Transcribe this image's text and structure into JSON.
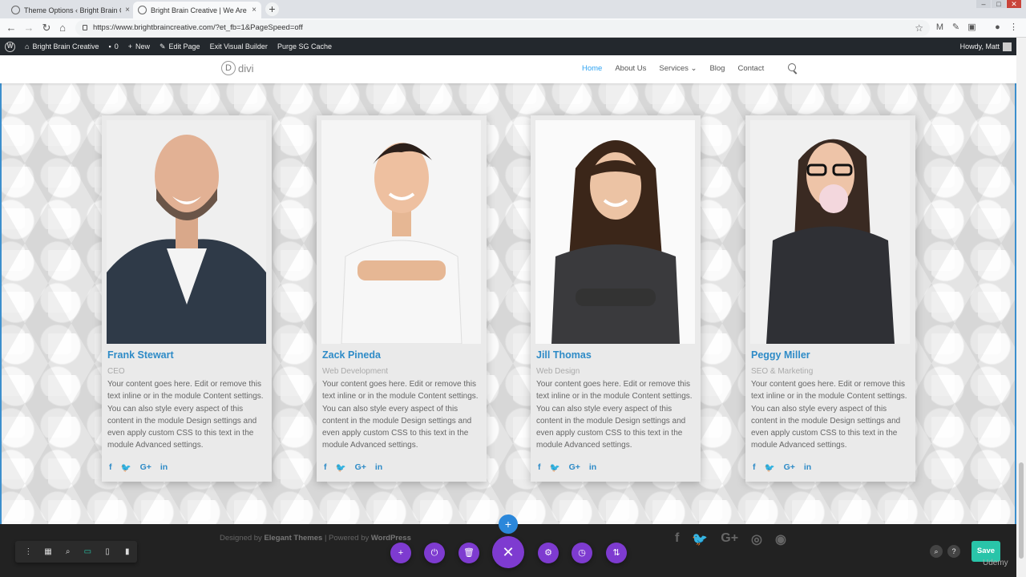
{
  "browser": {
    "tabs": [
      {
        "title": "Theme Options ‹ Bright Brain Cre",
        "close": "×"
      },
      {
        "title": "Bright Brain Creative | We Are Br",
        "close": "×"
      }
    ],
    "new_tab": "+",
    "url": "https://www.brightbraincreative.com/?et_fb=1&PageSpeed=off"
  },
  "wp_admin_bar": {
    "site_name": "Bright Brain Creative",
    "comments_count": "0",
    "new_label": "New",
    "edit_page_label": "Edit Page",
    "exit_vb_label": "Exit Visual Builder",
    "purge_label": "Purge SG Cache",
    "howdy": "Howdy, Matt"
  },
  "site": {
    "logo_text": "divi",
    "logo_mark": "D",
    "menu": [
      {
        "label": "Home",
        "current": true
      },
      {
        "label": "About Us"
      },
      {
        "label": "Services ⌄"
      },
      {
        "label": "Blog"
      },
      {
        "label": "Contact"
      }
    ]
  },
  "team": [
    {
      "name": "Frank Stewart",
      "role": "CEO",
      "desc": "Your content goes here. Edit or remove this text inline or in the module Content settings. You can also style every aspect of this content in the module Design settings and even apply custom CSS to this text in the module Advanced settings."
    },
    {
      "name": "Zack Pineda",
      "role": "Web Development",
      "desc": "Your content goes here. Edit or remove this text inline or in the module Content settings. You can also style every aspect of this content in the module Design settings and even apply custom CSS to this text in the module Advanced settings."
    },
    {
      "name": "Jill Thomas",
      "role": "Web Design",
      "desc": "Your content goes here. Edit or remove this text inline or in the module Content settings. You can also style every aspect of this content in the module Design settings and even apply custom CSS to this text in the module Advanced settings."
    },
    {
      "name": "Peggy Miller",
      "role": "SEO & Marketing",
      "desc": "Your content goes here. Edit or remove this text inline or in the module Content settings. You can also style every aspect of this content in the module Design settings and even apply custom CSS to this text in the module Advanced settings."
    }
  ],
  "social_glyphs": {
    "facebook": "f",
    "twitter": "🐦",
    "google": "G+",
    "linkedin": "in"
  },
  "footer": {
    "designed_by": "Designed by",
    "elegant": "Elegant Themes",
    "powered_by": "| Powered by",
    "wordpress": "WordPress",
    "social": [
      "f",
      "🐦",
      "G+",
      "◎",
      "◉"
    ]
  },
  "builder": {
    "add_row": "+",
    "left_icons": [
      "⋮",
      "▦",
      "⌕",
      "▭",
      "▯",
      "▮"
    ],
    "center_buttons": [
      "+",
      "⏻",
      "🗑",
      "✕",
      "⚙",
      "◷",
      "⇅"
    ],
    "right_icons": [
      "⌕",
      "?"
    ],
    "save_label": "Save"
  },
  "watermark": "Udemy",
  "colors": {
    "accent": "#2ea3f2",
    "builder_purple": "#7e3bd0",
    "save_green": "#29c4a9"
  }
}
